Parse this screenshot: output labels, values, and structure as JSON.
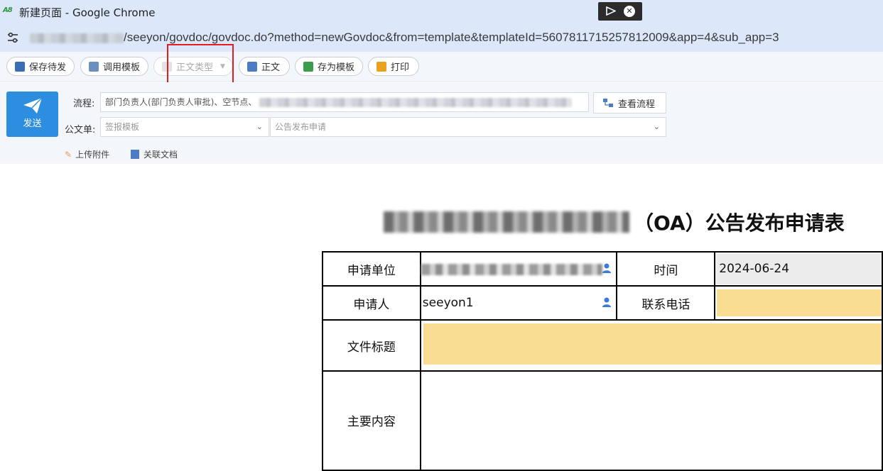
{
  "window": {
    "logo_text": "A8",
    "title": "新建页面 - Google Chrome"
  },
  "address_bar": {
    "url": "/seeyon/govdoc/govdoc.do?method=newGovdoc&from=template&templateId=5607811715257812009&app=4&sub_app=3"
  },
  "toolbar": {
    "save_draft": "保存待发",
    "use_template": "调用模板",
    "body_type": "正文类型",
    "body": "正文",
    "save_as_template": "存为模板",
    "print": "打印"
  },
  "form_header": {
    "send_label": "发送",
    "flow_label": "流程:",
    "flow_value": "部门负责人(部门负责人审批)、空节点、",
    "view_flow": "查看流程",
    "doc_form_label": "公文单:",
    "sign_template_placeholder": "签报模板",
    "doc_form_value": "公告发布申请",
    "upload_attachment": "上传附件",
    "related_docs": "关联文档"
  },
  "document": {
    "title_suffix": "（OA）公告发布申请表",
    "rows": {
      "apply_unit_label": "申请单位",
      "time_label": "时间",
      "time_value": "2024-06-24",
      "applicant_label": "申请人",
      "applicant_value": "seeyon1",
      "phone_label": "联系电话",
      "doc_title_label": "文件标题",
      "main_content_label": "主要内容"
    }
  },
  "colors": {
    "accent": "#2d8ee0",
    "highlight": "#e02020",
    "editable_field": "#f9dd92"
  }
}
